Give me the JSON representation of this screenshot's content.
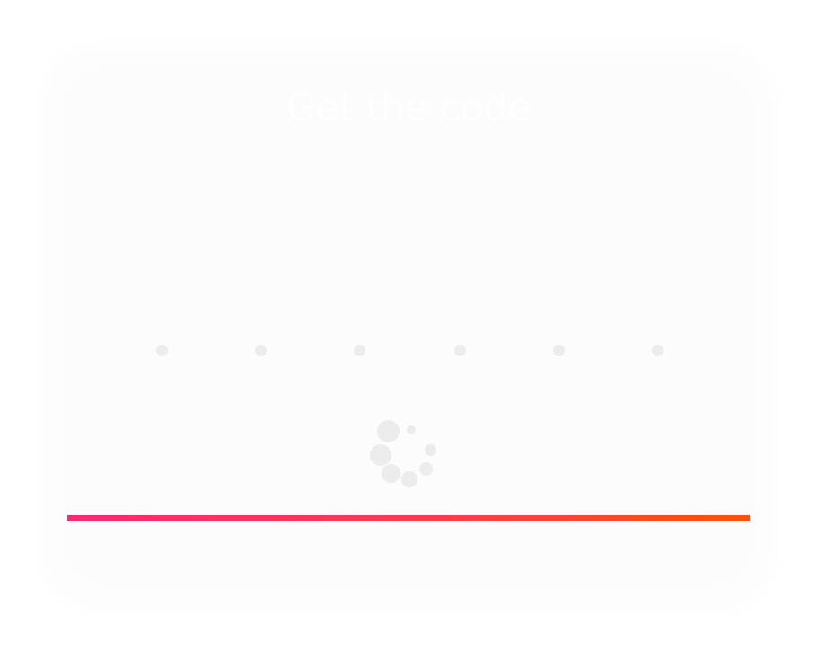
{
  "dialog": {
    "title": "Get the code",
    "subtitle": ""
  },
  "code_input": {
    "digits": [
      "",
      "",
      "",
      "",
      "",
      ""
    ]
  },
  "loading": {
    "indicator": "spinner-icon"
  },
  "progress": {
    "fraction": 1.0,
    "gradient_start": "#f92a74",
    "gradient_end": "#f85012"
  }
}
